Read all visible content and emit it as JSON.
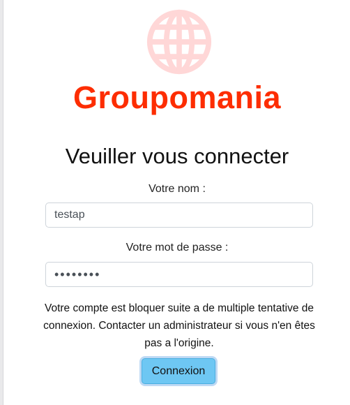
{
  "brand": {
    "name": "Groupomania",
    "icon": "globe-icon",
    "color": "#fd2d01",
    "icon_color": "#ffd7d7"
  },
  "page": {
    "title": "Veuiller vous connecter"
  },
  "form": {
    "name_label": "Votre nom :",
    "name_value": "testap",
    "password_label": "Votre mot de passe :",
    "password_value": "testtest",
    "error_message": "Votre compte est bloquer suite a de multiple tentative de connexion. Contacter un administrateur si vous n'en êtes pas a l'origine.",
    "submit_label": "Connexion"
  },
  "colors": {
    "button": "#6ec7f3",
    "background": "#ffffff"
  }
}
